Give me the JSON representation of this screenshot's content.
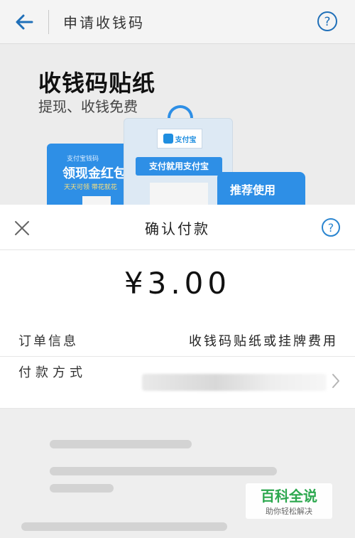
{
  "header": {
    "title": "申请收钱码",
    "back_icon": "arrow-left-icon",
    "help_icon": "question-circle-icon",
    "accent_color": "#1f6fb8"
  },
  "hero": {
    "title": "收钱码贴纸",
    "subtitle": "提现、收钱免费",
    "sticker_left_small": "支付宝钱码",
    "sticker_left_big": "领现金红包",
    "sticker_left_tiny": "天天可领  带花就花",
    "card_logo": "支付宝",
    "card_band": "支付就用支付宝",
    "sticker_right": "推荐使用"
  },
  "payment_sheet": {
    "title": "确认付款",
    "close_icon": "close-icon",
    "help_icon": "question-circle-icon",
    "amount": "¥3.00",
    "order_info_label": "订单信息",
    "order_info_value": "收钱码贴纸或挂牌费用",
    "payment_method_label": "付款方式",
    "payment_method_value": "",
    "chevron_icon": "chevron-right-icon"
  },
  "watermark": {
    "main": "百科全说",
    "sub": "助你轻松解决",
    "color": "#2da84f"
  }
}
